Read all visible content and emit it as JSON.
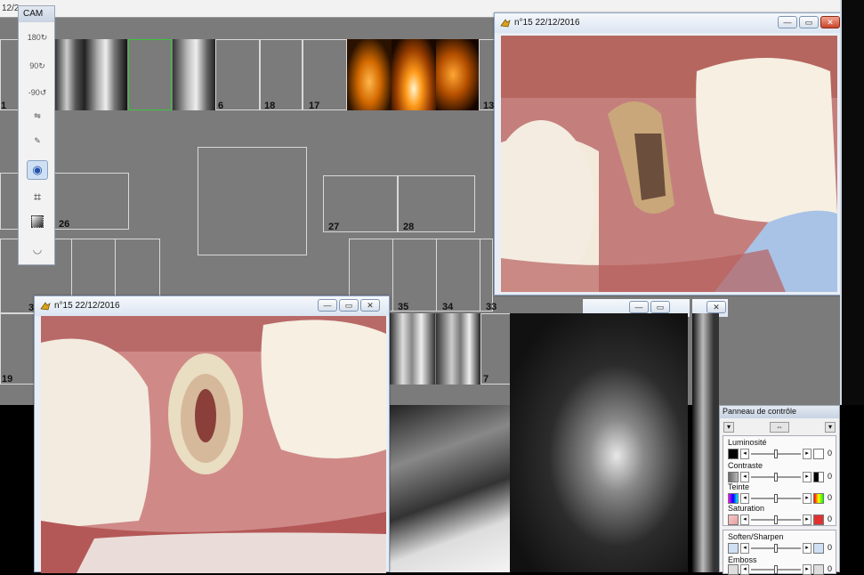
{
  "topbar": {
    "date_partial": "12/2"
  },
  "chart": {
    "slots_top": [
      "1",
      "6",
      "18",
      "17",
      "13"
    ],
    "slots_mid": [
      "26",
      "27",
      "28"
    ],
    "slots_bottom": [
      "3",
      "35",
      "34",
      "33",
      "19",
      "7"
    ]
  },
  "cam_toolbar": {
    "title": "CAM",
    "tools": [
      "rotate-180-icon",
      "rotate-90-icon",
      "rotate-minus-90-icon",
      "flip-icon",
      "pen-icon",
      "eye-image-icon",
      "crop-icon",
      "gradient-icon",
      "lips-icon"
    ],
    "tool_labels": [
      "180",
      "90",
      "-90"
    ]
  },
  "window_top": {
    "title": "n°15 22/12/2016"
  },
  "window_bottom": {
    "title": "n°15 22/12/2016"
  },
  "window_buttons": {
    "minimize": "—",
    "maximize": "▭",
    "close": "✕"
  },
  "control_panel": {
    "title": "Panneau de contrôle",
    "sliders": [
      {
        "label": "Luminosité",
        "value": "0"
      },
      {
        "label": "Contraste",
        "value": "0"
      },
      {
        "label": "Teinte",
        "value": "0"
      },
      {
        "label": "Saturation",
        "value": "0"
      }
    ],
    "sliders2": [
      {
        "label": "Soften/Sharpen",
        "value": "0"
      },
      {
        "label": "Emboss",
        "value": "0"
      }
    ]
  }
}
